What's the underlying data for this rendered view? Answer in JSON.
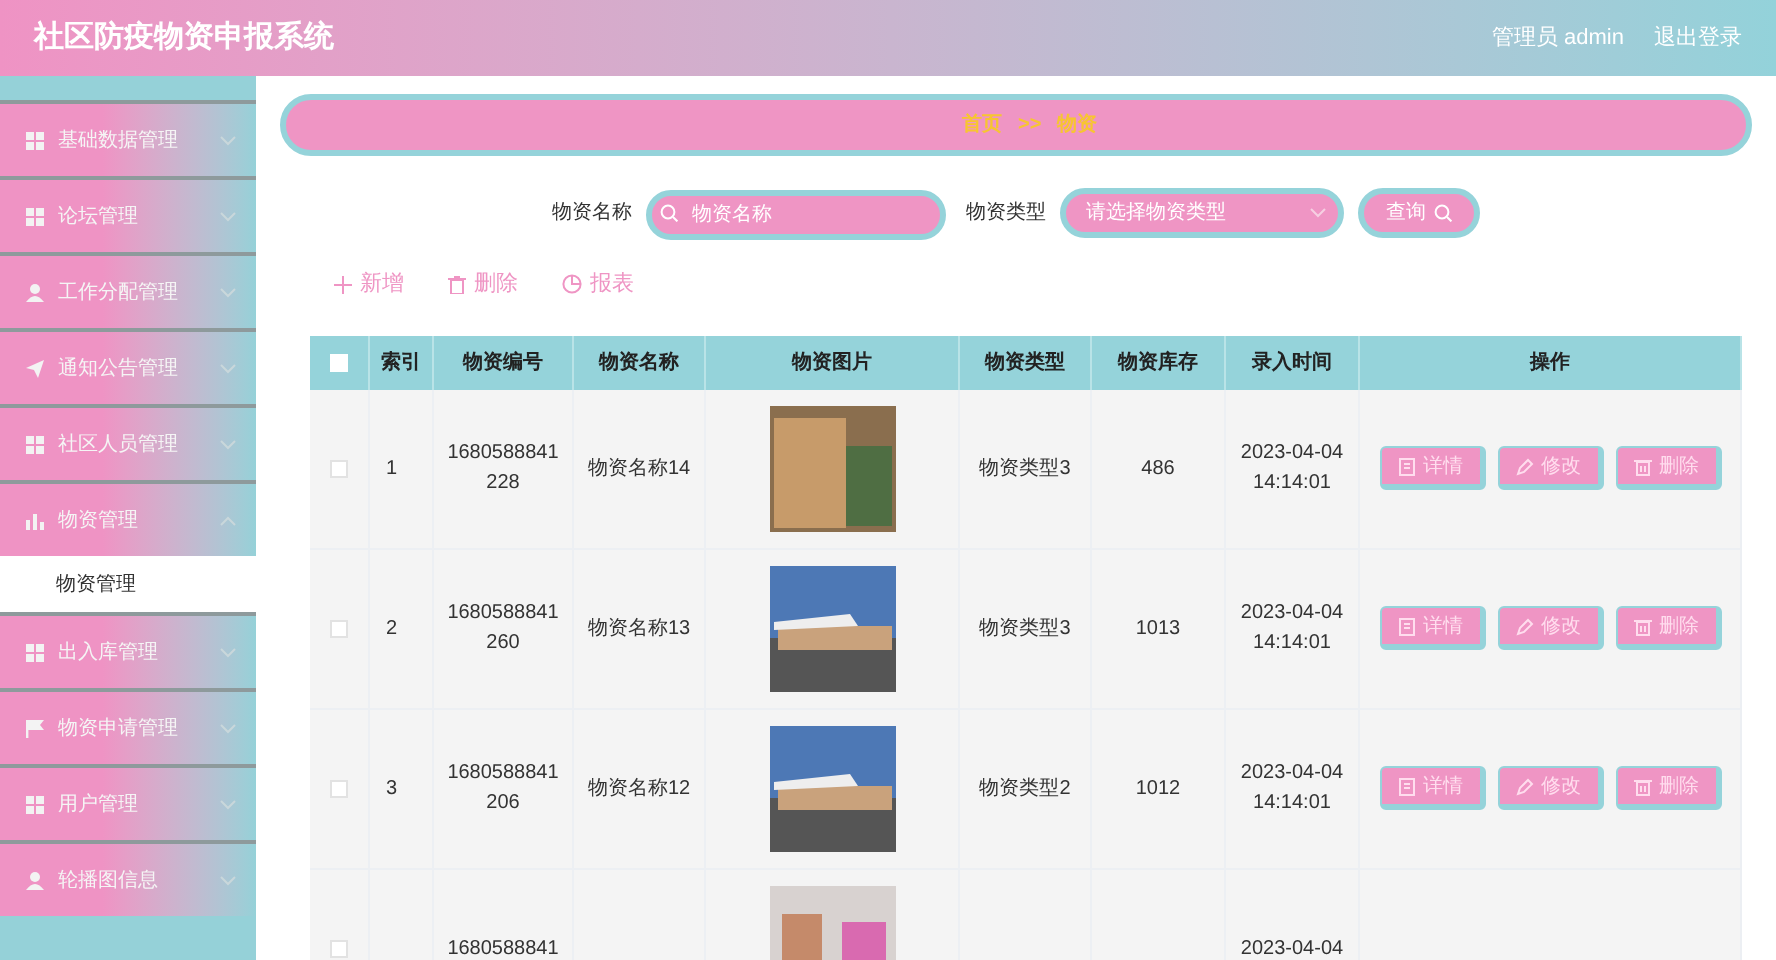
{
  "header": {
    "title": "社区防疫物资申报系统",
    "user": "管理员 admin",
    "logout": "退出登录"
  },
  "sidebar": {
    "items": [
      {
        "label": "基础数据管理",
        "expanded": false
      },
      {
        "label": "论坛管理",
        "expanded": false
      },
      {
        "label": "工作分配管理",
        "expanded": false
      },
      {
        "label": "通知公告管理",
        "expanded": false
      },
      {
        "label": "社区人员管理",
        "expanded": false
      },
      {
        "label": "物资管理",
        "expanded": true,
        "children": [
          {
            "label": "物资管理",
            "selected": true
          }
        ]
      },
      {
        "label": "出入库管理",
        "expanded": false
      },
      {
        "label": "物资申请管理",
        "expanded": false
      },
      {
        "label": "用户管理",
        "expanded": false
      },
      {
        "label": "轮播图信息",
        "expanded": false
      }
    ]
  },
  "breadcrumb": [
    "首页",
    ">>",
    "物资"
  ],
  "search": {
    "name_label": "物资名称",
    "name_placeholder": "物资名称",
    "type_label": "物资类型",
    "type_placeholder": "请选择物资类型",
    "button": "查询"
  },
  "actions": [
    "新增",
    "删除",
    "报表"
  ],
  "table": {
    "all_checked": false,
    "columns": [
      "索引",
      "物资编号",
      "物资名称",
      "物资图片",
      "物资类型",
      "物资库存",
      "录入时间",
      "操作"
    ],
    "rows": [
      {
        "checked": false,
        "index": "1",
        "code": "1680588841\n228",
        "name": "物资名称14",
        "kind": "boxes",
        "type": "物资类型3",
        "stock": "486",
        "time": "2023-04-04\n14:14:01",
        "buttons": [
          "详情",
          "修改",
          "删除"
        ]
      },
      {
        "checked": false,
        "index": "2",
        "code": "1680588841\n260",
        "name": "物资名称13",
        "kind": "plane",
        "type": "物资类型3",
        "stock": "1013",
        "time": "2023-04-04\n14:14:01",
        "buttons": [
          "详情",
          "修改",
          "删除"
        ]
      },
      {
        "checked": false,
        "index": "3",
        "code": "1680588841\n206",
        "name": "物资名称12",
        "kind": "plane",
        "type": "物资类型2",
        "stock": "1012",
        "time": "2023-04-04\n14:14:01",
        "buttons": [
          "详情",
          "修改",
          "删除"
        ]
      },
      {
        "checked": false,
        "code": "1680588841",
        "kind": "room",
        "time": "2023-04-04"
      }
    ]
  }
}
